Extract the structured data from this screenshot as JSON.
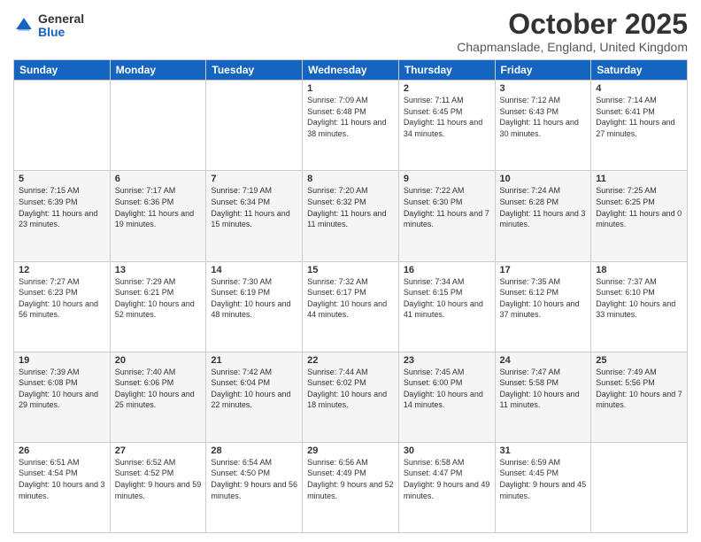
{
  "header": {
    "logo_general": "General",
    "logo_blue": "Blue",
    "month_title": "October 2025",
    "subtitle": "Chapmanslade, England, United Kingdom"
  },
  "days_of_week": [
    "Sunday",
    "Monday",
    "Tuesday",
    "Wednesday",
    "Thursday",
    "Friday",
    "Saturday"
  ],
  "weeks": [
    [
      {
        "day": "",
        "info": ""
      },
      {
        "day": "",
        "info": ""
      },
      {
        "day": "",
        "info": ""
      },
      {
        "day": "1",
        "info": "Sunrise: 7:09 AM\nSunset: 6:48 PM\nDaylight: 11 hours and 38 minutes."
      },
      {
        "day": "2",
        "info": "Sunrise: 7:11 AM\nSunset: 6:45 PM\nDaylight: 11 hours and 34 minutes."
      },
      {
        "day": "3",
        "info": "Sunrise: 7:12 AM\nSunset: 6:43 PM\nDaylight: 11 hours and 30 minutes."
      },
      {
        "day": "4",
        "info": "Sunrise: 7:14 AM\nSunset: 6:41 PM\nDaylight: 11 hours and 27 minutes."
      }
    ],
    [
      {
        "day": "5",
        "info": "Sunrise: 7:15 AM\nSunset: 6:39 PM\nDaylight: 11 hours and 23 minutes."
      },
      {
        "day": "6",
        "info": "Sunrise: 7:17 AM\nSunset: 6:36 PM\nDaylight: 11 hours and 19 minutes."
      },
      {
        "day": "7",
        "info": "Sunrise: 7:19 AM\nSunset: 6:34 PM\nDaylight: 11 hours and 15 minutes."
      },
      {
        "day": "8",
        "info": "Sunrise: 7:20 AM\nSunset: 6:32 PM\nDaylight: 11 hours and 11 minutes."
      },
      {
        "day": "9",
        "info": "Sunrise: 7:22 AM\nSunset: 6:30 PM\nDaylight: 11 hours and 7 minutes."
      },
      {
        "day": "10",
        "info": "Sunrise: 7:24 AM\nSunset: 6:28 PM\nDaylight: 11 hours and 3 minutes."
      },
      {
        "day": "11",
        "info": "Sunrise: 7:25 AM\nSunset: 6:25 PM\nDaylight: 11 hours and 0 minutes."
      }
    ],
    [
      {
        "day": "12",
        "info": "Sunrise: 7:27 AM\nSunset: 6:23 PM\nDaylight: 10 hours and 56 minutes."
      },
      {
        "day": "13",
        "info": "Sunrise: 7:29 AM\nSunset: 6:21 PM\nDaylight: 10 hours and 52 minutes."
      },
      {
        "day": "14",
        "info": "Sunrise: 7:30 AM\nSunset: 6:19 PM\nDaylight: 10 hours and 48 minutes."
      },
      {
        "day": "15",
        "info": "Sunrise: 7:32 AM\nSunset: 6:17 PM\nDaylight: 10 hours and 44 minutes."
      },
      {
        "day": "16",
        "info": "Sunrise: 7:34 AM\nSunset: 6:15 PM\nDaylight: 10 hours and 41 minutes."
      },
      {
        "day": "17",
        "info": "Sunrise: 7:35 AM\nSunset: 6:12 PM\nDaylight: 10 hours and 37 minutes."
      },
      {
        "day": "18",
        "info": "Sunrise: 7:37 AM\nSunset: 6:10 PM\nDaylight: 10 hours and 33 minutes."
      }
    ],
    [
      {
        "day": "19",
        "info": "Sunrise: 7:39 AM\nSunset: 6:08 PM\nDaylight: 10 hours and 29 minutes."
      },
      {
        "day": "20",
        "info": "Sunrise: 7:40 AM\nSunset: 6:06 PM\nDaylight: 10 hours and 25 minutes."
      },
      {
        "day": "21",
        "info": "Sunrise: 7:42 AM\nSunset: 6:04 PM\nDaylight: 10 hours and 22 minutes."
      },
      {
        "day": "22",
        "info": "Sunrise: 7:44 AM\nSunset: 6:02 PM\nDaylight: 10 hours and 18 minutes."
      },
      {
        "day": "23",
        "info": "Sunrise: 7:45 AM\nSunset: 6:00 PM\nDaylight: 10 hours and 14 minutes."
      },
      {
        "day": "24",
        "info": "Sunrise: 7:47 AM\nSunset: 5:58 PM\nDaylight: 10 hours and 11 minutes."
      },
      {
        "day": "25",
        "info": "Sunrise: 7:49 AM\nSunset: 5:56 PM\nDaylight: 10 hours and 7 minutes."
      }
    ],
    [
      {
        "day": "26",
        "info": "Sunrise: 6:51 AM\nSunset: 4:54 PM\nDaylight: 10 hours and 3 minutes."
      },
      {
        "day": "27",
        "info": "Sunrise: 6:52 AM\nSunset: 4:52 PM\nDaylight: 9 hours and 59 minutes."
      },
      {
        "day": "28",
        "info": "Sunrise: 6:54 AM\nSunset: 4:50 PM\nDaylight: 9 hours and 56 minutes."
      },
      {
        "day": "29",
        "info": "Sunrise: 6:56 AM\nSunset: 4:49 PM\nDaylight: 9 hours and 52 minutes."
      },
      {
        "day": "30",
        "info": "Sunrise: 6:58 AM\nSunset: 4:47 PM\nDaylight: 9 hours and 49 minutes."
      },
      {
        "day": "31",
        "info": "Sunrise: 6:59 AM\nSunset: 4:45 PM\nDaylight: 9 hours and 45 minutes."
      },
      {
        "day": "",
        "info": ""
      }
    ]
  ]
}
